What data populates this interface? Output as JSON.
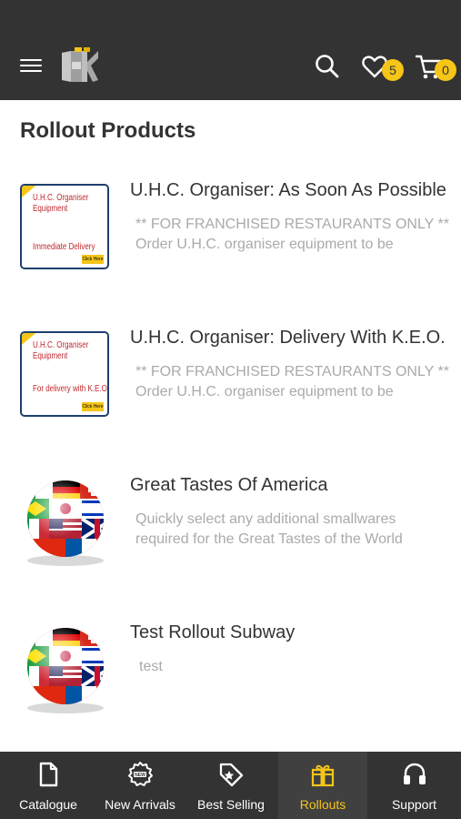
{
  "header": {
    "menu_icon": "hamburger-menu-icon",
    "logo_icon": "hk-logo-icon",
    "search_icon": "search-icon",
    "wishlist_icon": "heart-icon",
    "wishlist_count": "5",
    "cart_icon": "shopping-cart-icon",
    "cart_count": "0",
    "accent": "#f5c518",
    "bar_color": "#333333"
  },
  "page": {
    "title": "Rollout Products"
  },
  "products": [
    {
      "title": "U.H.C. Organiser: As Soon As Possible",
      "desc_line1": "** FOR FRANCHISED RESTAURANTS ONLY **",
      "desc_line2": "Order U.H.C. organiser equipment to be",
      "thumb_type": "flyer",
      "thumb_heading": "U.H.C. Organiser Equipment",
      "thumb_sub": "Immediate Delivery",
      "thumb_tag": "Click Here"
    },
    {
      "title": "U.H.C. Organiser: Delivery With K.E.O.",
      "desc_line1": "** FOR FRANCHISED RESTAURANTS ONLY **",
      "desc_line2": "Order U.H.C. organiser equipment to be",
      "thumb_type": "flyer",
      "thumb_heading": "U.H.C. Organiser Equipment",
      "thumb_sub": "For delivery with K.E.O",
      "thumb_tag": "Click Here"
    },
    {
      "title": "Great Tastes Of America",
      "desc_line1": "Quickly select any additional smallwares",
      "desc_line2": "required for the Great Tastes of the World",
      "thumb_type": "flag-globe"
    },
    {
      "title": "Test Rollout Subway",
      "desc_line1": "test",
      "desc_line2": "",
      "thumb_type": "flag-globe"
    }
  ],
  "bottom_nav": {
    "items": [
      {
        "label": "Catalogue",
        "icon": "document-icon",
        "active": false
      },
      {
        "label": "New Arrivals",
        "icon": "new-badge-icon",
        "active": false
      },
      {
        "label": "Best Selling",
        "icon": "star-tag-icon",
        "active": false
      },
      {
        "label": "Rollouts",
        "icon": "gift-box-icon",
        "active": true
      },
      {
        "label": "Support",
        "icon": "headset-icon",
        "active": false
      }
    ]
  }
}
